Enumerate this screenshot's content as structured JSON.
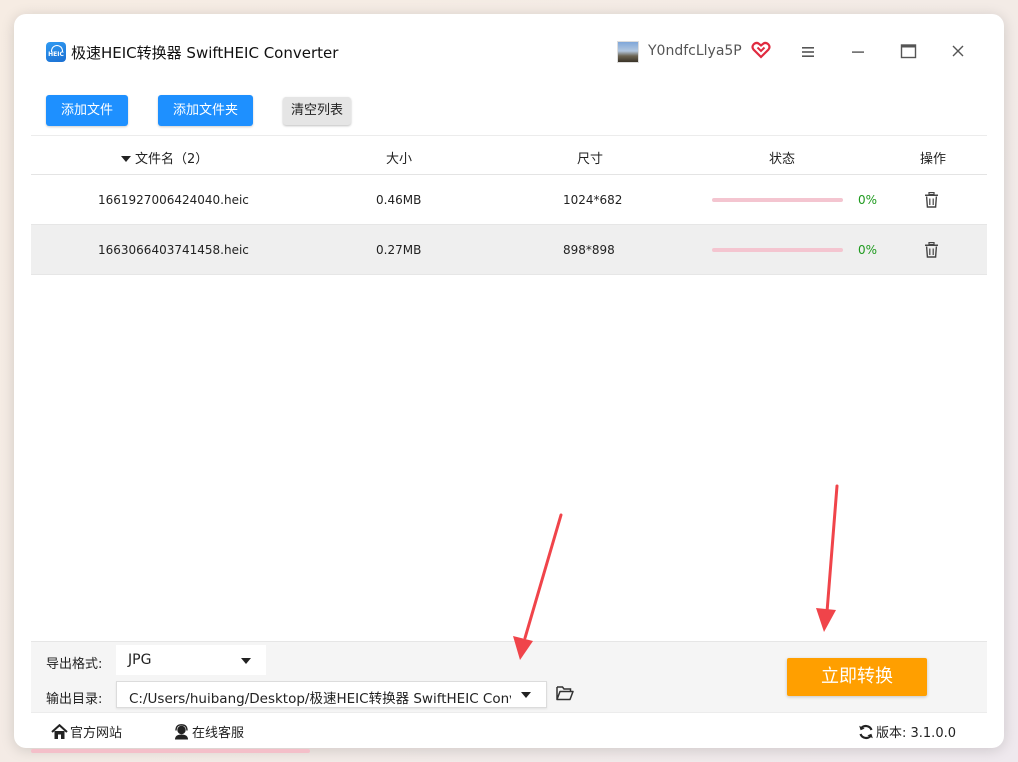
{
  "app": {
    "title": "极速HEIC转换器 SwiftHEIC Converter",
    "logo_text": "HEIC",
    "user_name": "Y0ndfcLlya5P"
  },
  "toolbar": {
    "add_file": "添加文件",
    "add_folder": "添加文件夹",
    "clear_list": "清空列表"
  },
  "table": {
    "headers": {
      "name": "文件名（2）",
      "size": "大小",
      "dimensions": "尺寸",
      "status": "状态",
      "action": "操作"
    },
    "rows": [
      {
        "name": "1661927006424040.heic",
        "size": "0.46MB",
        "dimensions": "1024*682",
        "progress": "0%"
      },
      {
        "name": "1663066403741458.heic",
        "size": "0.27MB",
        "dimensions": "898*898",
        "progress": "0%"
      }
    ]
  },
  "output": {
    "format_label": "导出格式:",
    "format_value": "JPG",
    "dir_label": "输出目录:",
    "dir_value": "C:/Users/huibang/Desktop/极速HEIC转换器 SwiftHEIC Converter",
    "convert_button": "立即转换"
  },
  "footer": {
    "website": "官方网站",
    "service": "在线客服",
    "version": "版本:  3.1.0.0"
  },
  "colors": {
    "primary": "#1e90ff",
    "accent": "#ff9f00",
    "progress_track": "#f4c5d0",
    "progress_text": "#1e9a1e",
    "annotation_arrow": "#f0444a"
  }
}
